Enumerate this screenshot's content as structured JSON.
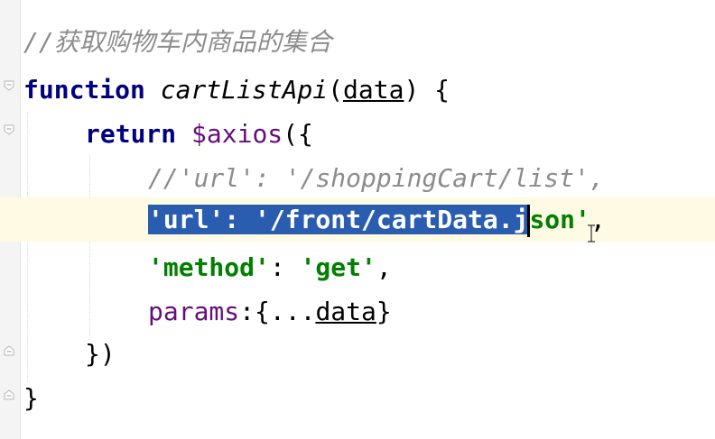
{
  "editor": {
    "lines": [
      {
        "comment": "//获取购物车内商品的集合"
      },
      {
        "kw": "function",
        "fn": "cartListApi",
        "open": "(",
        "param": "data",
        "close": ") {"
      },
      {
        "kw": "return",
        "var": "$axios",
        "rest": "({"
      },
      {
        "comment": "//'url': '/shoppingCart/list',"
      },
      {
        "sel_text": "'url': '/front/cartData.j",
        "after_str": "son'",
        "after": ","
      },
      {
        "str1": "'method'",
        "colon": ": ",
        "str2": "'get'",
        "comma": ","
      },
      {
        "key": "params",
        "mid": ":{...",
        "param": "data",
        "end": "}"
      },
      {
        "text": "})"
      },
      {
        "text": "}"
      }
    ]
  }
}
